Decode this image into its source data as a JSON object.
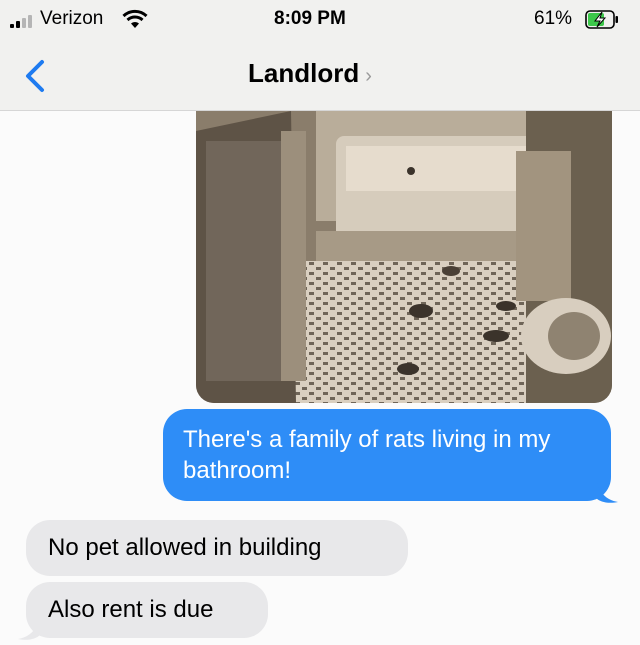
{
  "status_bar": {
    "carrier": "Verizon",
    "time": "8:09 PM",
    "battery": "61%",
    "signal_bars": 2,
    "charging": true
  },
  "nav": {
    "contact_name": "Landlord",
    "chevron": "›",
    "back_icon": "back-chevron-icon"
  },
  "messages": [
    {
      "type": "image",
      "from": "me",
      "description_icon": "bathroom-photo"
    },
    {
      "type": "text",
      "from": "me",
      "text": "There's a family of rats living in my bathroom!"
    },
    {
      "type": "text",
      "from": "them",
      "text": "No pet allowed in building"
    },
    {
      "type": "text",
      "from": "them",
      "text": "Also rent is due"
    }
  ],
  "colors": {
    "sent_bubble": "#2e8df7",
    "received_bubble": "#e8e8ea",
    "accent": "#1e7bf0",
    "battery_charging": "#3cc84a"
  }
}
